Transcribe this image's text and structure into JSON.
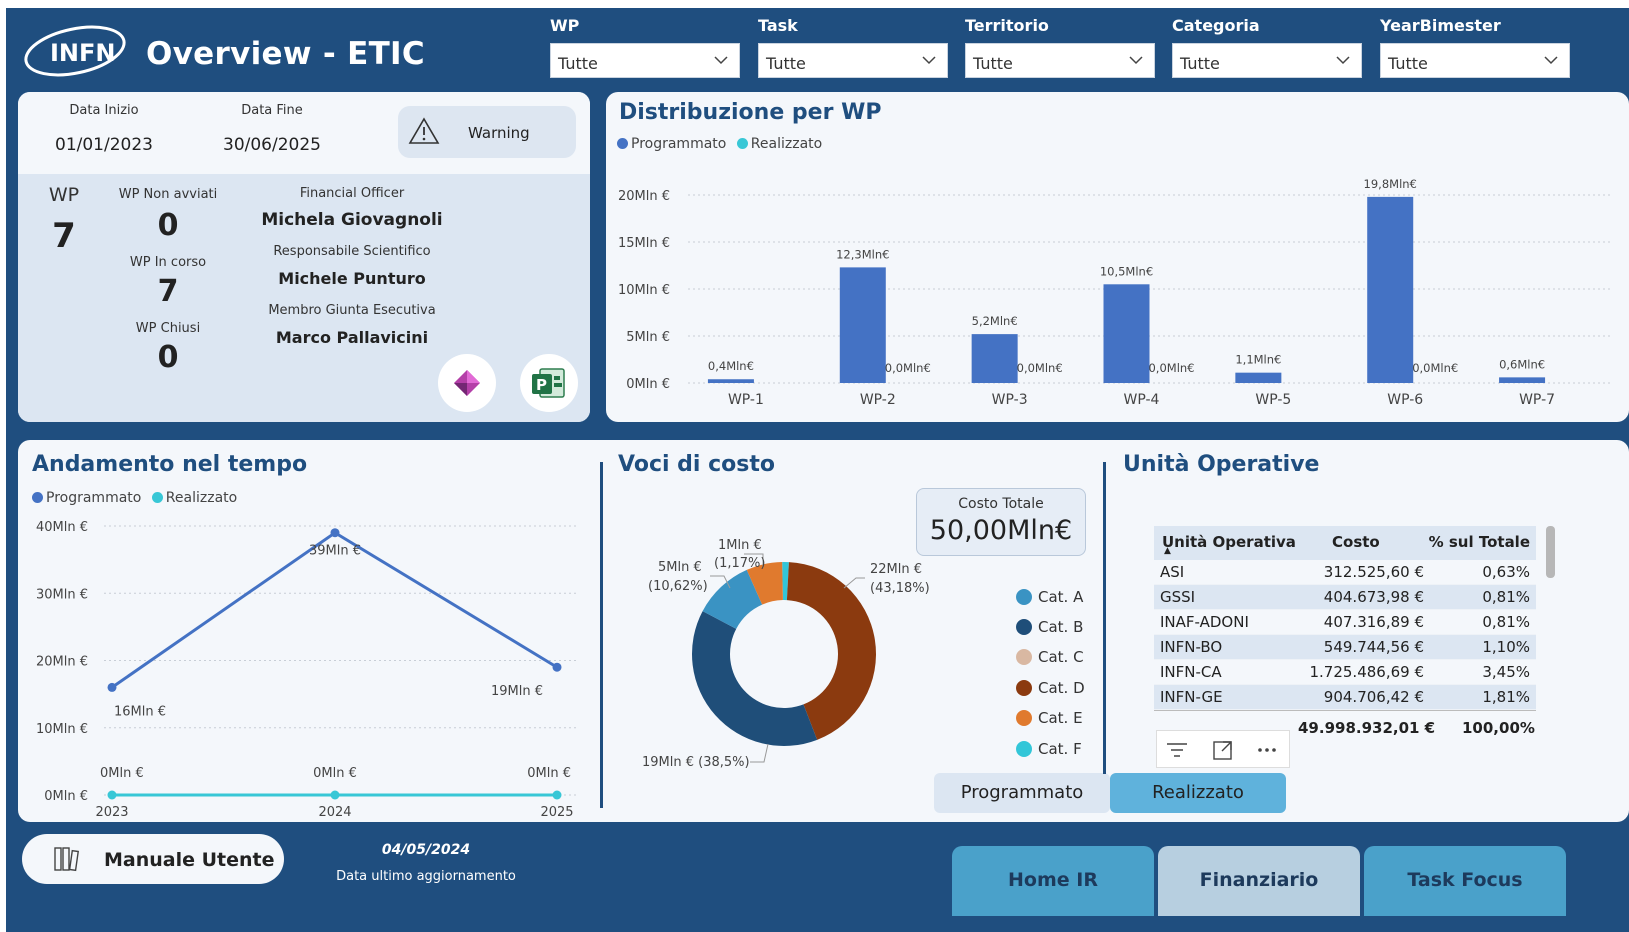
{
  "header": {
    "logo_text": "INFN",
    "title": "Overview - ETIC",
    "filters": [
      {
        "label": "WP",
        "value": "Tutte"
      },
      {
        "label": "Task",
        "value": "Tutte"
      },
      {
        "label": "Territorio",
        "value": "Tutte"
      },
      {
        "label": "Categoria",
        "value": "Tutte"
      },
      {
        "label": "YearBimester",
        "value": "Tutte"
      }
    ]
  },
  "info": {
    "data_inizio_label": "Data Inizio",
    "data_inizio": "01/01/2023",
    "data_fine_label": "Data Fine",
    "data_fine": "30/06/2025",
    "warning_label": "Warning",
    "wp_label": "WP",
    "wp_value": "7",
    "wp_non_avviati_label": "WP Non avviati",
    "wp_non_avviati": "0",
    "wp_in_corso_label": "WP In corso",
    "wp_in_corso": "7",
    "wp_chiusi_label": "WP Chiusi",
    "wp_chiusi": "0",
    "financial_officer_label": "Financial Officer",
    "financial_officer": "Michela Giovagnoli",
    "resp_scientifico_label": "Responsabile Scientifico",
    "resp_scientifico": "Michele Punturo",
    "membro_giunta_label": "Membro Giunta Esecutiva",
    "membro_giunta": "Marco Pallavicini"
  },
  "colors": {
    "programmato": "#4472c4",
    "realizzato": "#38c7d6",
    "cat_a": "#3a93c3",
    "cat_b": "#1f4e79",
    "cat_c": "#d9b8a2",
    "cat_d": "#8b3a0f",
    "cat_e": "#e07a2e",
    "cat_f": "#32c6d8"
  },
  "dist_wp": {
    "title": "Distribuzione per WP",
    "legend_programmato": "Programmato",
    "legend_realizzato": "Realizzato",
    "chart_data": {
      "type": "bar",
      "categories": [
        "WP-1",
        "WP-2",
        "WP-3",
        "WP-4",
        "WP-5",
        "WP-6",
        "WP-7"
      ],
      "series": [
        {
          "name": "Programmato",
          "values": [
            0.4,
            12.3,
            5.2,
            10.5,
            1.1,
            19.8,
            0.6
          ],
          "labels": [
            "0,4Mln€",
            "12,3Mln€",
            "5,2Mln€",
            "10,5Mln€",
            "1,1Mln€",
            "19,8Mln€",
            "0,6Mln€"
          ]
        },
        {
          "name": "Realizzato",
          "values": [
            0,
            0,
            0,
            0,
            0,
            0,
            0
          ],
          "labels": [
            "",
            "0,0Mln€",
            "0,0Mln€",
            "0,0Mln€",
            "",
            "0,0Mln€",
            ""
          ]
        }
      ],
      "yticks": [
        0,
        5,
        10,
        15,
        20
      ],
      "ytick_labels": [
        "0Mln €",
        "5Mln €",
        "10Mln €",
        "15Mln €",
        "20Mln €"
      ],
      "ylim": [
        0,
        21
      ]
    }
  },
  "andamento": {
    "title": "Andamento nel tempo",
    "legend_programmato": "Programmato",
    "legend_realizzato": "Realizzato",
    "chart_data": {
      "type": "line",
      "x": [
        "2023",
        "2024",
        "2025"
      ],
      "series": [
        {
          "name": "Programmato",
          "values": [
            16,
            39,
            19
          ],
          "labels": [
            "16Mln €",
            "39Mln €",
            "19Mln €"
          ]
        },
        {
          "name": "Realizzato",
          "values": [
            0,
            0,
            0
          ],
          "labels": [
            "0Mln €",
            "0Mln €",
            "0Mln €"
          ]
        }
      ],
      "yticks": [
        0,
        10,
        20,
        30,
        40
      ],
      "ytick_labels": [
        "0Mln €",
        "10Mln €",
        "20Mln €",
        "30Mln €",
        "40Mln €"
      ],
      "ylim": [
        0,
        40
      ]
    }
  },
  "voci": {
    "title": "Voci di costo",
    "costo_totale_label": "Costo Totale",
    "costo_totale": "50,00Mln€",
    "chart_data": {
      "type": "pie",
      "categories": [
        "Cat. A",
        "Cat. B",
        "Cat. C",
        "Cat. D",
        "Cat. E",
        "Cat. F"
      ],
      "values": [
        10.62,
        38.5,
        0,
        43.18,
        6.3,
        1.17
      ],
      "data_labels": [
        {
          "cat": "Cat. A",
          "l1": "5Mln €",
          "l2": "(10,62%)"
        },
        {
          "cat": "Cat. B",
          "l1": "19Mln € (38,5%)",
          "l2": ""
        },
        {
          "cat": "Cat. D",
          "l1": "22Mln €",
          "l2": "(43,18%)"
        },
        {
          "cat": "Cat. F",
          "l1": "1Mln €",
          "l2": "(1,17%)"
        }
      ]
    },
    "toggle_programmato": "Programmato",
    "toggle_realizzato": "Realizzato"
  },
  "unita": {
    "title": "Unità Operative",
    "headers": [
      "Unità Operativa",
      "Costo",
      "% sul Totale"
    ],
    "rows": [
      {
        "uo": "ASI",
        "costo": "312.525,60 €",
        "pct": "0,63%"
      },
      {
        "uo": "GSSI",
        "costo": "404.673,98 €",
        "pct": "0,81%"
      },
      {
        "uo": "INAF-ADONI",
        "costo": "407.316,89 €",
        "pct": "0,81%"
      },
      {
        "uo": "INFN-BO",
        "costo": "549.744,56 €",
        "pct": "1,10%"
      },
      {
        "uo": "INFN-CA",
        "costo": "1.725.486,69 €",
        "pct": "3,45%"
      },
      {
        "uo": "INFN-GE",
        "costo": "904.706,42 €",
        "pct": "1,81%"
      }
    ],
    "total_costo": "49.998.932,01 €",
    "total_pct": "100,00%"
  },
  "footer": {
    "manual_label": "Manuale Utente",
    "date": "04/05/2024",
    "date_caption": "Data ultimo aggiornamento",
    "tabs": [
      "Home IR",
      "Finanziario",
      "Task Focus"
    ]
  }
}
